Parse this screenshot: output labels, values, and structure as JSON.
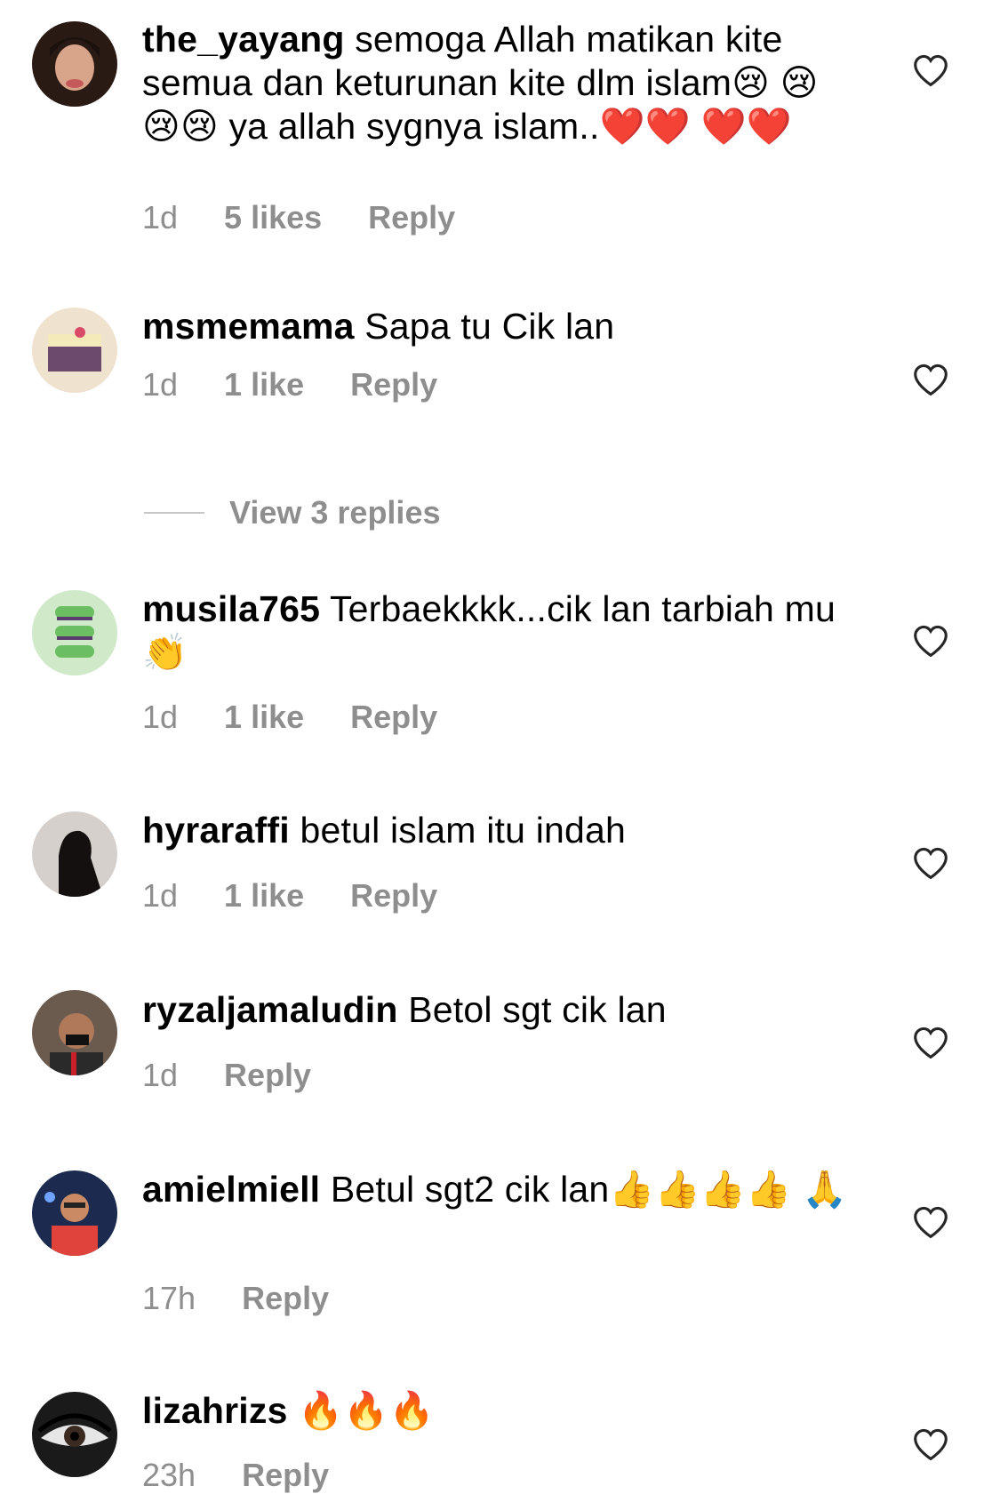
{
  "comments": [
    {
      "username": "the_yayang",
      "text": "semoga Allah matikan kite semua dan keturunan kite dlm islam😢 😢😢😢  ya allah sygnya islam..❤️❤️ ❤️❤️",
      "time": "1d",
      "likes": "5 likes",
      "reply": "Reply"
    },
    {
      "username": "msmemama",
      "text": "Sapa tu Cik lan",
      "time": "1d",
      "likes": "1 like",
      "reply": "Reply"
    },
    {
      "username": "musila765",
      "text": "Terbaekkkk...cik lan tarbiah mu👏",
      "time": "1d",
      "likes": "1 like",
      "reply": "Reply"
    },
    {
      "username": "hyraraffi",
      "text": "betul islam itu indah",
      "time": "1d",
      "likes": "1 like",
      "reply": "Reply"
    },
    {
      "username": "ryzaljamaludin",
      "text": "Betol sgt cik lan",
      "time": "1d",
      "reply": "Reply"
    },
    {
      "username": "amielmiell",
      "text": "Betul sgt2 cik lan👍👍👍👍 🙏",
      "time": "17h",
      "reply": "Reply"
    },
    {
      "username": "lizahrizs",
      "text": "🔥🔥🔥",
      "time": "23h",
      "reply": "Reply"
    }
  ],
  "view_replies": {
    "label": "View 3 replies"
  }
}
